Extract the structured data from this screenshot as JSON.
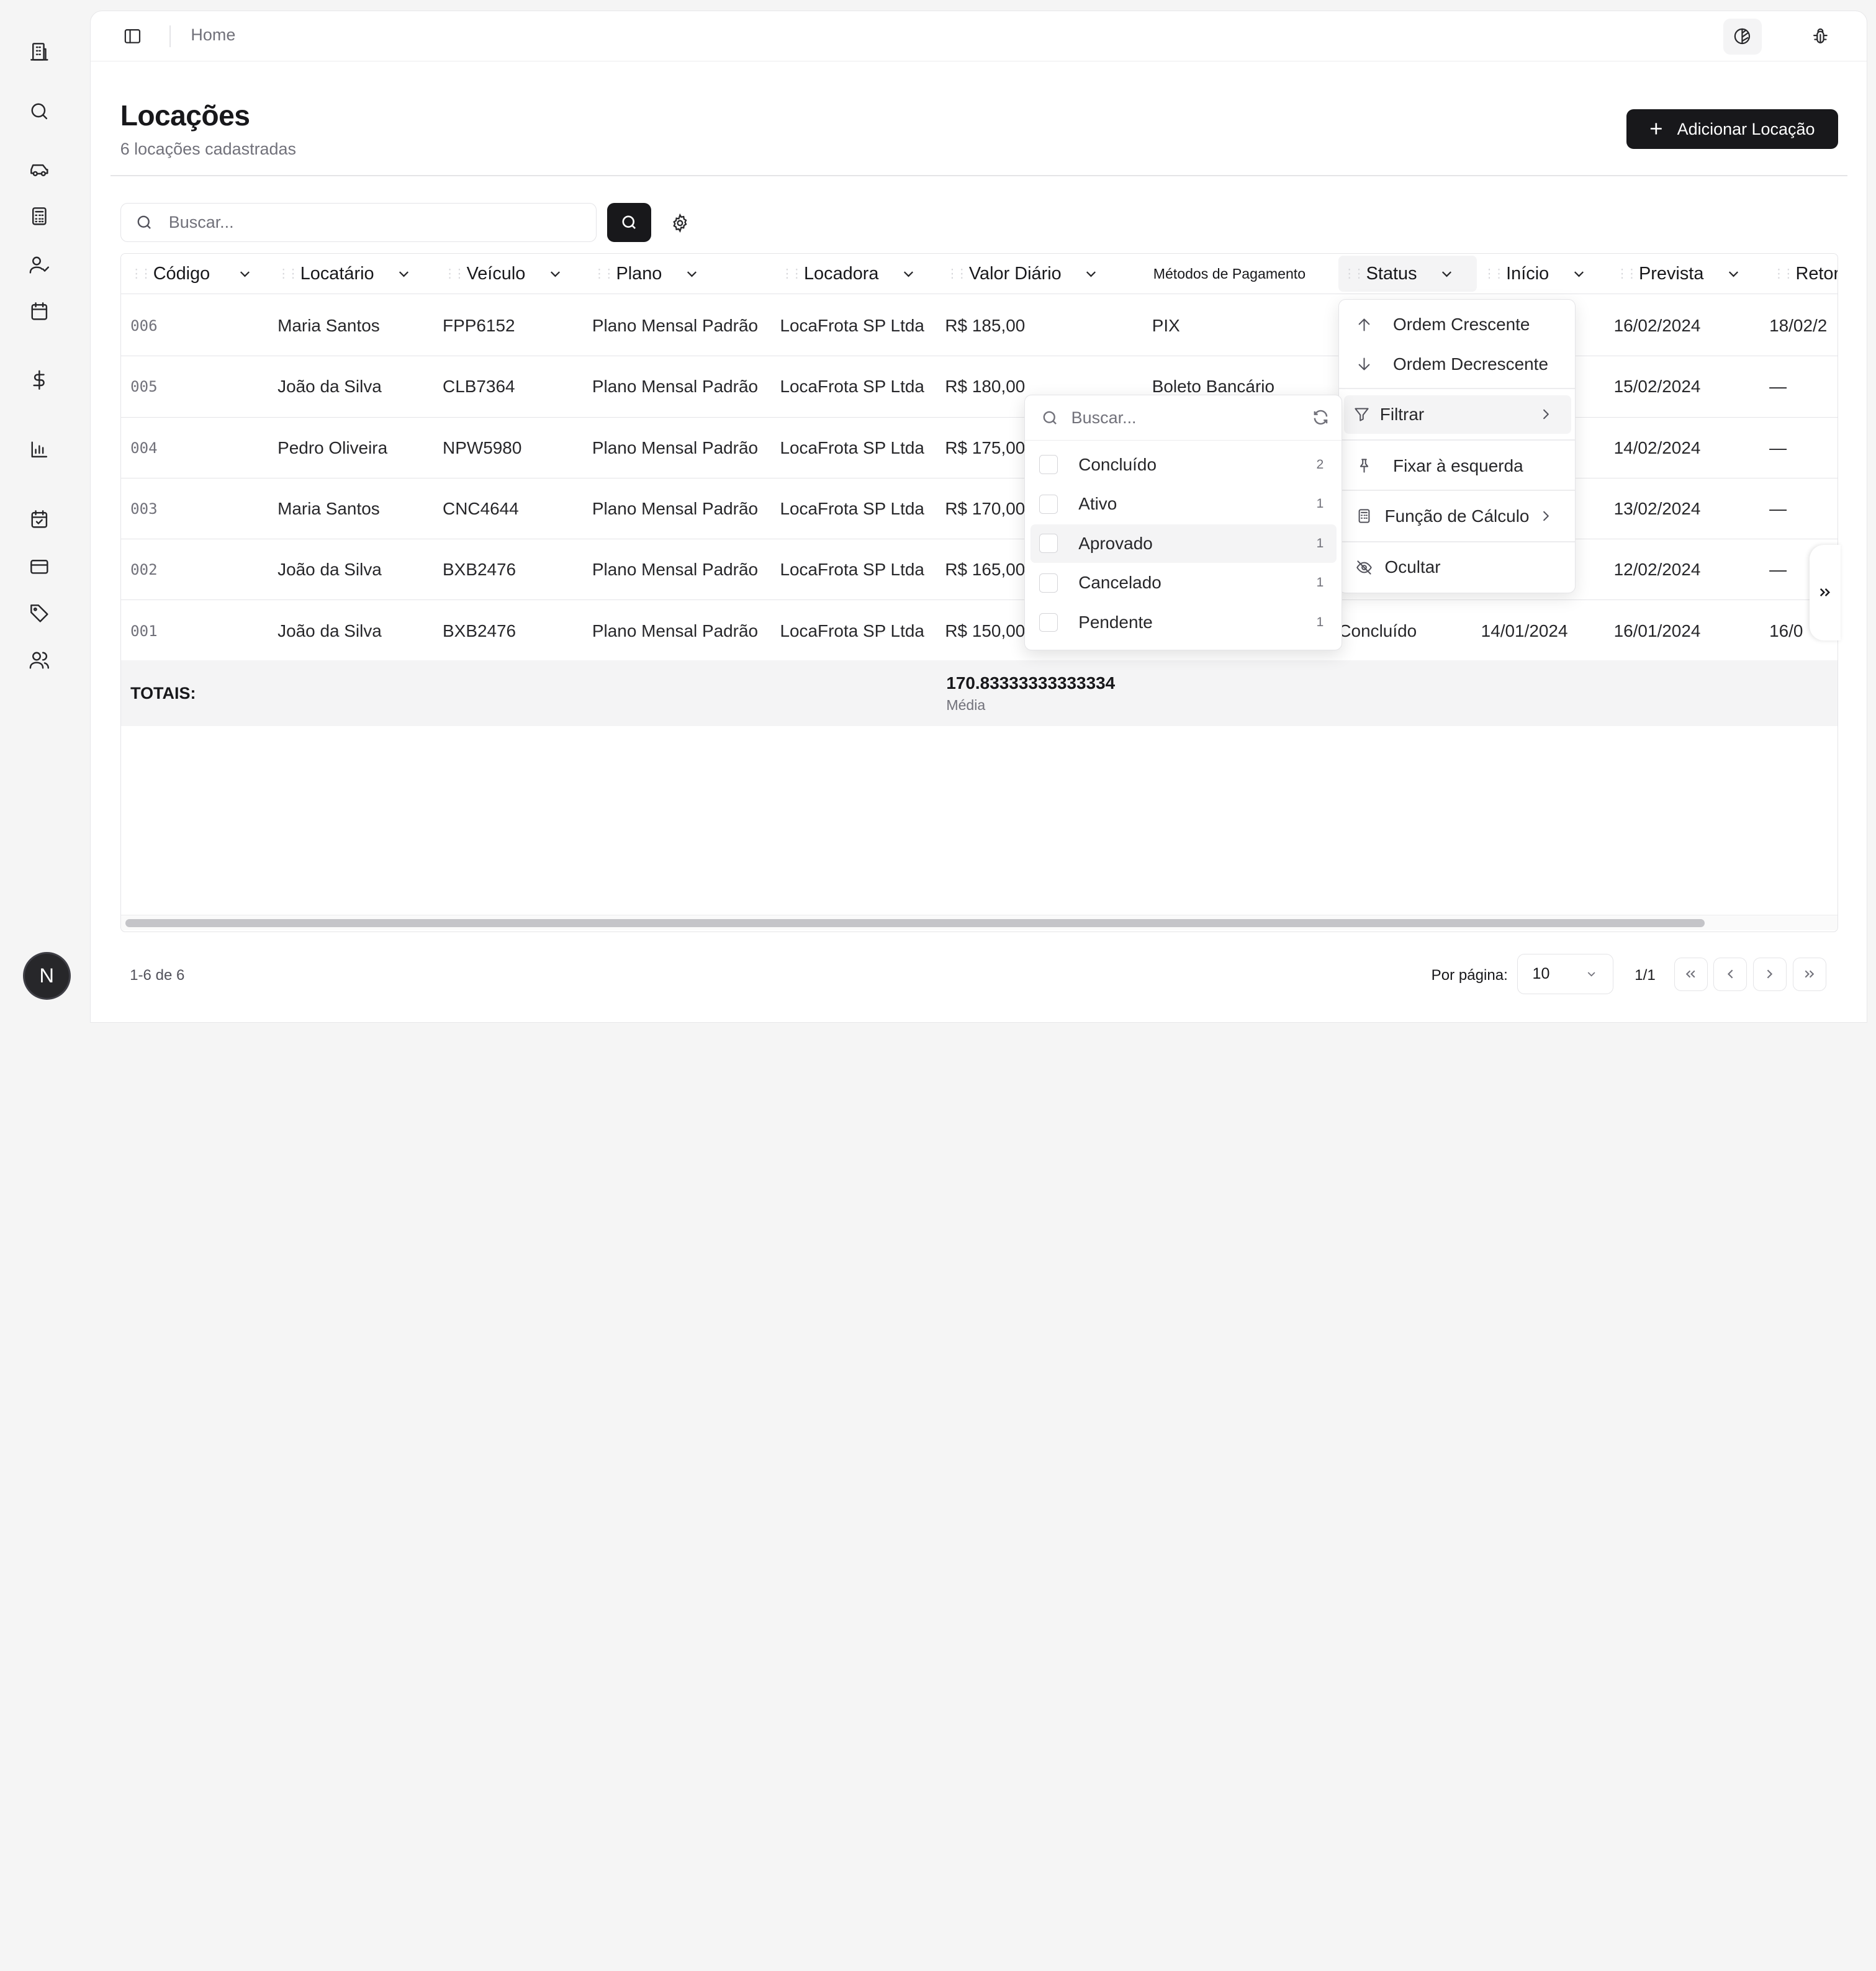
{
  "sidebar": {
    "icons": [
      "building-icon",
      "search-icon",
      "car-icon",
      "calculator-icon",
      "user-check-icon",
      "calendar-icon",
      "dollar-icon",
      "bar-chart-icon",
      "calendar-check-icon",
      "credit-card-icon",
      "tag-icon",
      "users-icon"
    ],
    "avatar_initial": "N"
  },
  "topbar": {
    "breadcrumb": "Home"
  },
  "page": {
    "title": "Locações",
    "subtitle": "6 locações cadastradas",
    "add_button": "Adicionar Locação"
  },
  "search": {
    "placeholder": "Buscar..."
  },
  "table": {
    "columns": [
      "Código",
      "Locatário",
      "Veículo",
      "Plano",
      "Locadora",
      "Valor Diário",
      "Métodos de Pagamento",
      "Status",
      "Início",
      "Prevista",
      "Retorno"
    ],
    "rows": [
      {
        "codigo": "006",
        "locatario": "Maria Santos",
        "veiculo": "FPP6152",
        "plano": "Plano Mensal Padrão",
        "locadora": "LocaFrota SP Ltda",
        "valor": "R$ 185,00",
        "metodos": "PIX",
        "status": "",
        "inicio": "",
        "prevista": "16/02/2024",
        "retorno": "18/02/2"
      },
      {
        "codigo": "005",
        "locatario": "João da Silva",
        "veiculo": "CLB7364",
        "plano": "Plano Mensal Padrão",
        "locadora": "LocaFrota SP Ltda",
        "valor": "R$ 180,00",
        "metodos": "Boleto Bancário",
        "status": "",
        "inicio": "",
        "prevista": "15/02/2024",
        "retorno": "—"
      },
      {
        "codigo": "004",
        "locatario": "Pedro Oliveira",
        "veiculo": "NPW5980",
        "plano": "Plano Mensal Padrão",
        "locadora": "LocaFrota SP Ltda",
        "valor": "R$ 175,00",
        "metodos": "",
        "status": "",
        "inicio": "",
        "prevista": "14/02/2024",
        "retorno": "—"
      },
      {
        "codigo": "003",
        "locatario": "Maria Santos",
        "veiculo": "CNC4644",
        "plano": "Plano Mensal Padrão",
        "locadora": "LocaFrota SP Ltda",
        "valor": "R$ 170,00",
        "metodos": "",
        "status": "",
        "inicio": "",
        "prevista": "13/02/2024",
        "retorno": "—"
      },
      {
        "codigo": "002",
        "locatario": "João da Silva",
        "veiculo": "BXB2476",
        "plano": "Plano Mensal Padrão",
        "locadora": "LocaFrota SP Ltda",
        "valor": "R$ 165,00",
        "metodos": "",
        "status": "",
        "inicio": "",
        "prevista": "12/02/2024",
        "retorno": "—"
      },
      {
        "codigo": "001",
        "locatario": "João da Silva",
        "veiculo": "BXB2476",
        "plano": "Plano Mensal Padrão",
        "locadora": "LocaFrota SP Ltda",
        "valor": "R$ 150,00",
        "metodos": "",
        "status": "Concluído",
        "inicio": "14/01/2024",
        "prevista": "16/01/2024",
        "retorno": "16/0"
      }
    ],
    "totals": {
      "label": "TOTAIS:",
      "value": "170.83333333333334",
      "sub": "Média"
    }
  },
  "column_menu": {
    "items": [
      "Ordem Crescente",
      "Ordem Decrescente",
      "Filtrar",
      "Fixar à esquerda",
      "Função de Cálculo",
      "Ocultar"
    ]
  },
  "filter_menu": {
    "placeholder": "Buscar...",
    "options": [
      {
        "label": "Concluído",
        "count": "2"
      },
      {
        "label": "Ativo",
        "count": "1"
      },
      {
        "label": "Aprovado",
        "count": "1"
      },
      {
        "label": "Cancelado",
        "count": "1"
      },
      {
        "label": "Pendente",
        "count": "1"
      }
    ]
  },
  "footer": {
    "count": "1-6 de 6",
    "per_page_label": "Por página:",
    "per_page_value": "10",
    "page_info": "1/1"
  }
}
